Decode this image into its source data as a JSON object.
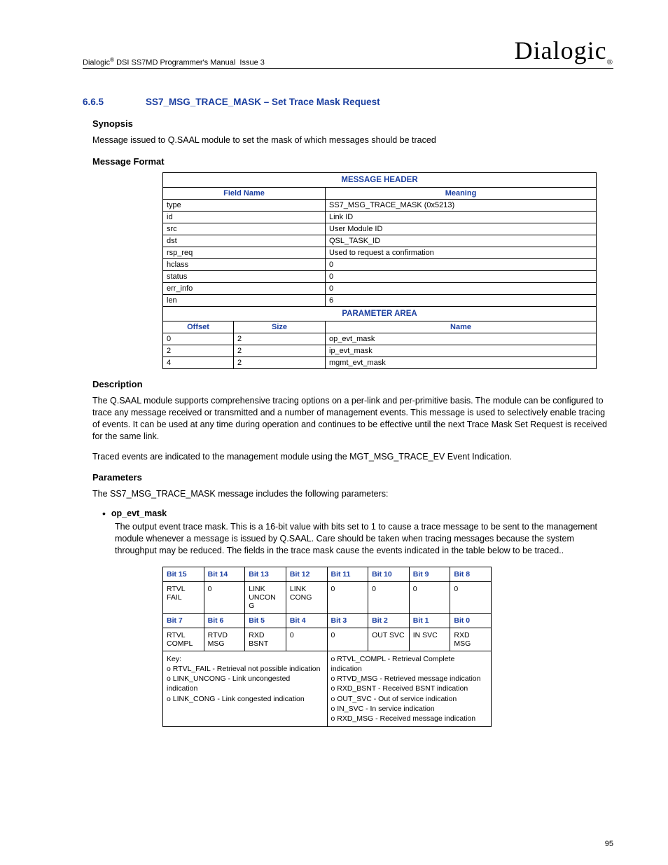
{
  "header": {
    "doc": "Dialogic® DSI SS7MD Programmer's Manual  Issue 3",
    "logo": "Dialogic",
    "logo_reg": "®"
  },
  "section": {
    "num": "6.6.5",
    "title": "SS7_MSG_TRACE_MASK – Set Trace Mask Request"
  },
  "synopsis_h": "Synopsis",
  "synopsis": "Message issued to Q.SAAL module to set the mask of which messages should be traced",
  "msgformat_h": "Message Format",
  "msg_header_title": "MESSAGE HEADER",
  "msg_cols": {
    "field": "Field Name",
    "meaning": "Meaning"
  },
  "msg_rows": [
    {
      "f": "type",
      "m": "SS7_MSG_TRACE_MASK (0x5213)"
    },
    {
      "f": "id",
      "m": "Link ID"
    },
    {
      "f": "src",
      "m": "User Module ID"
    },
    {
      "f": "dst",
      "m": "QSL_TASK_ID"
    },
    {
      "f": "rsp_req",
      "m": "Used to request a confirmation"
    },
    {
      "f": "hclass",
      "m": "0"
    },
    {
      "f": "status",
      "m": "0"
    },
    {
      "f": "err_info",
      "m": "0"
    },
    {
      "f": "len",
      "m": "6"
    }
  ],
  "param_area_title": "PARAMETER AREA",
  "param_cols": {
    "off": "Offset",
    "size": "Size",
    "name": "Name"
  },
  "param_rows": [
    {
      "o": "0",
      "s": "2",
      "n": "op_evt_mask"
    },
    {
      "o": "2",
      "s": "2",
      "n": "ip_evt_mask"
    },
    {
      "o": "4",
      "s": "2",
      "n": "mgmt_evt_mask"
    }
  ],
  "desc_h": "Description",
  "desc1": "The Q.SAAL module supports comprehensive tracing options on a per-link and per-primitive basis. The module can be configured to trace any message received or transmitted and a number of management events. This message is used to selectively enable tracing of events. It can be used at any time during operation and continues to be effective until the next Trace Mask Set Request is received for the same link.",
  "desc2": "Traced events are indicated to the management module using the MGT_MSG_TRACE_EV Event Indication.",
  "params_h": "Parameters",
  "params_intro": "The SS7_MSG_TRACE_MASK message includes the following parameters:",
  "p1": {
    "name": "op_evt_mask",
    "body": "The output event trace mask. This is a 16-bit value with bits set to 1 to cause a trace message to be sent to the management module whenever a message is issued by Q.SAAL. Care should be taken when tracing messages because the system throughput may be reduced. The fields in the trace mask cause the events indicated in the table below to be traced.."
  },
  "bits": {
    "h1": [
      "Bit 15",
      "Bit 14",
      "Bit 13",
      "Bit 12",
      "Bit 11",
      "Bit 10",
      "Bit 9",
      "Bit 8"
    ],
    "r1": [
      "RTVL FAIL",
      "0",
      "LINK UNCON G",
      "LINK CONG",
      "0",
      "0",
      "0",
      "0"
    ],
    "h2": [
      "Bit 7",
      "Bit 6",
      "Bit 5",
      "Bit 4",
      "Bit 3",
      "Bit 2",
      "Bit 1",
      "Bit 0"
    ],
    "r2": [
      "RTVL COMPL",
      "RTVD MSG",
      "RXD BSNT",
      "0",
      "0",
      "OUT SVC",
      "IN SVC",
      "RXD MSG"
    ]
  },
  "key": {
    "left": "Key:\no RTVL_FAIL - Retrieval not possible indication\no LINK_UNCONG - Link uncongested indication\no LINK_CONG - Link congested indication",
    "right": "o RTVL_COMPL - Retrieval Complete indication\no RTVD_MSG - Retrieved message indication\no RXD_BSNT - Received BSNT indication\no OUT_SVC - Out of service indication\no IN_SVC - In service indication\no RXD_MSG - Received message indication"
  },
  "page": "95"
}
